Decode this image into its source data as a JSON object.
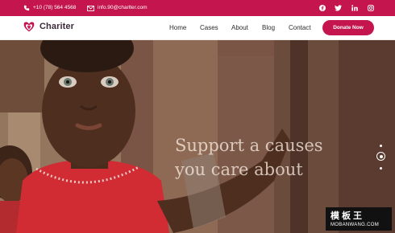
{
  "topbar": {
    "phone": "+10 (78) 564 4568",
    "email": "info.90@charlter.com",
    "phone_icon": "phone-icon",
    "email_icon": "mail-icon",
    "socials": [
      "facebook-icon",
      "twitter-icon",
      "linkedin-icon",
      "instagram-icon"
    ],
    "color": "#c4154f"
  },
  "header": {
    "brand": "Chariter",
    "nav": [
      "Home",
      "Cases",
      "About",
      "Blog",
      "Contact"
    ],
    "cta": "Donate Now"
  },
  "hero": {
    "headline_line1": "Support a causes",
    "headline_line2": "you care about",
    "slides": 3,
    "active_slide": 2
  },
  "watermark": {
    "top": "模板王",
    "bottom": "MOBANWANG.COM"
  }
}
